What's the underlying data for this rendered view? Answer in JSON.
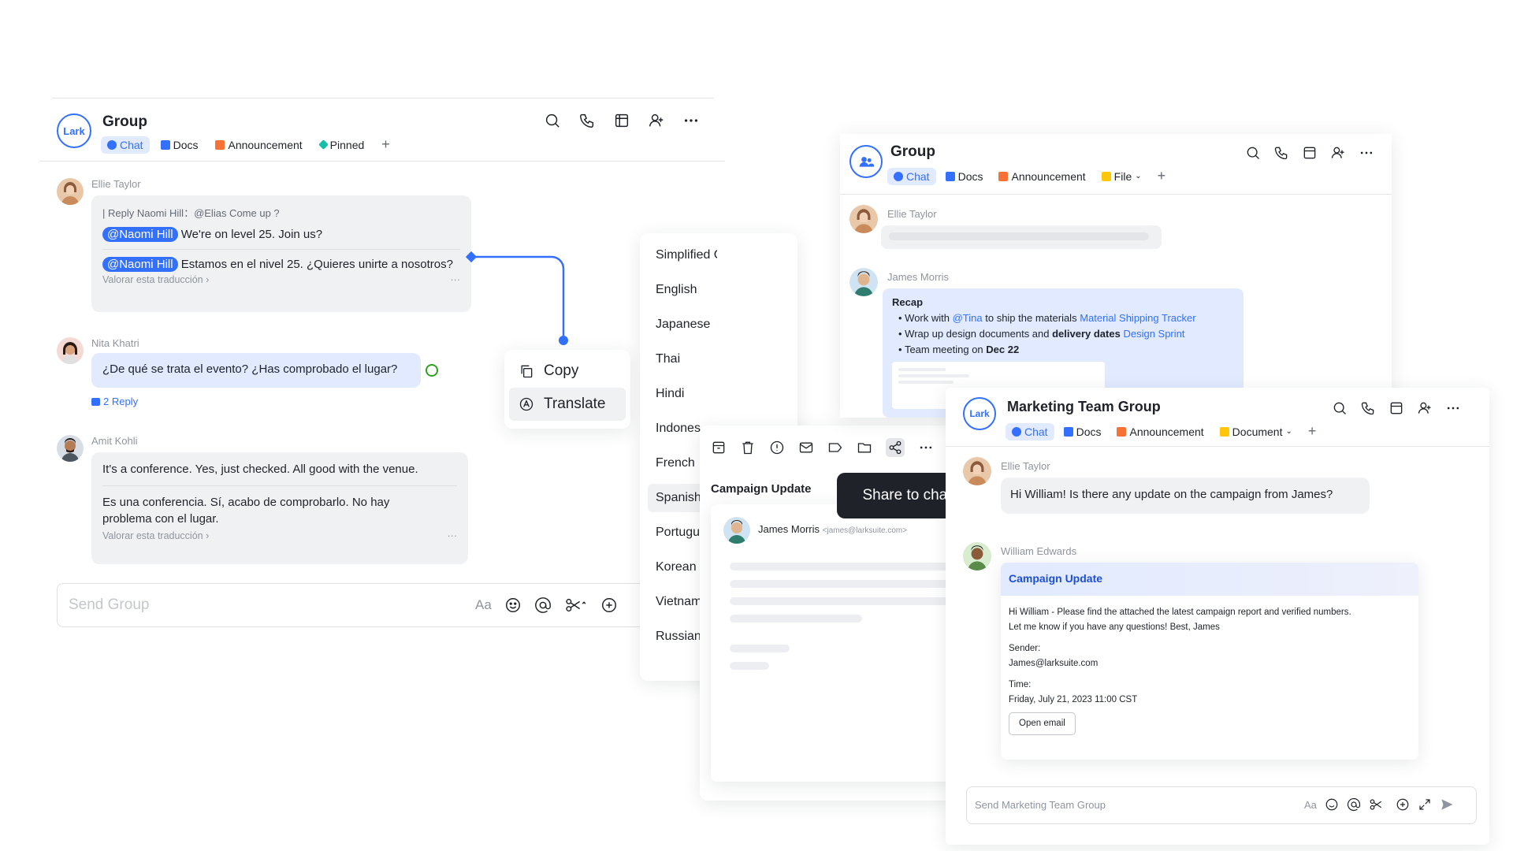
{
  "left": {
    "title": "Group",
    "logo": "Lark",
    "tabs": [
      {
        "label": "Chat",
        "icon": "chat-icon",
        "color": "#3370ff"
      },
      {
        "label": "Docs",
        "icon": "docs-icon",
        "color": "#3370ff"
      },
      {
        "label": "Announcement",
        "icon": "megaphone-icon",
        "color": "#f77234"
      },
      {
        "label": "Pinned",
        "icon": "pin-icon",
        "color": "#14c0a6"
      }
    ],
    "add_tab": "+",
    "msg1": {
      "sender": "Ellie Taylor",
      "reply": "| Reply Naomi Hill：@Elias Come up ?",
      "mention": "@Naomi Hill",
      "text_en": "We're on level 25. Join us?",
      "text_es": "Estamos en el nivel 25. ¿Quieres unirte a nosotros?",
      "rate": "Valorar esta traducción",
      "more": "···"
    },
    "msg2": {
      "sender": "Nita Khatri",
      "text": "¿De qué se trata el evento? ¿Has comprobado el lugar?",
      "reply_count": "2 Reply"
    },
    "msg3": {
      "sender": "Amit Kohli",
      "text_en": "It's a conference. Yes, just checked. All good with the venue.",
      "text_es_1": "Es una conferencia. Sí, acabo de comprobarlo. No hay",
      "text_es_2": "problema con el lugar.",
      "rate": "Valorar esta traducción",
      "more": "···"
    },
    "input_placeholder": "Send Group",
    "input_aa": "Aa"
  },
  "context_menu": {
    "copy": "Copy",
    "translate": "Translate"
  },
  "languages": [
    "Simplified Chinese",
    "English",
    "Japanese",
    "Thai",
    "Hindi",
    "Indones",
    "French",
    "Spanish",
    "Portugu",
    "Korean",
    "Vietnam",
    "Russian"
  ],
  "selected_language": "Spanish",
  "email_panel": {
    "title": "Campaign Update",
    "sender": "James Morris",
    "email": "<james@larksuite.com>",
    "tooltip": "Share to chat"
  },
  "middle": {
    "title": "Group",
    "tabs": [
      {
        "label": "Chat"
      },
      {
        "label": "Docs"
      },
      {
        "label": "Announcement"
      },
      {
        "label": "File"
      }
    ],
    "add_tab": "+",
    "msg1_sender": "Ellie Taylor",
    "msg2_sender": "James Morris",
    "recap": {
      "title": "Recap",
      "b1_pre": "Work with ",
      "b1_mention": "@Tina",
      "b1_mid": " to ship the materials ",
      "b1_link": "Material Shipping Tracker",
      "b2_pre": "Wrap up design documents and ",
      "b2_bold": "delivery dates",
      "b2_link": "Design Sprint",
      "b3_pre": "Team meeting on ",
      "b3_bold": "Dec 22"
    }
  },
  "right": {
    "title": "Marketing Team Group",
    "logo": "Lark",
    "tabs": [
      {
        "label": "Chat"
      },
      {
        "label": "Docs"
      },
      {
        "label": "Announcement"
      },
      {
        "label": "Document"
      }
    ],
    "add_tab": "+",
    "msg1": {
      "sender": "Ellie Taylor",
      "text": "Hi William! Is there any update on the campaign from James?"
    },
    "msg2": {
      "sender": "William Edwards",
      "card_title": "Campaign Update",
      "body_1": "Hi William - Please find the attached the latest campaign report and verified numbers.",
      "body_2": "Let me know if you have any questions! Best, James",
      "sender_label": "Sender:",
      "sender_value": "James@larksuite.com",
      "time_label": "Time:",
      "time_value": "Friday, July 21, 2023 11:00 CST",
      "button": "Open email"
    },
    "input_placeholder": "Send Marketing Team Group",
    "input_aa": "Aa"
  },
  "colors": {
    "accent": "#3370ff",
    "bubble_gray": "#f0f1f3",
    "bubble_blue": "#e1eaff",
    "tooltip": "#1f2329"
  }
}
